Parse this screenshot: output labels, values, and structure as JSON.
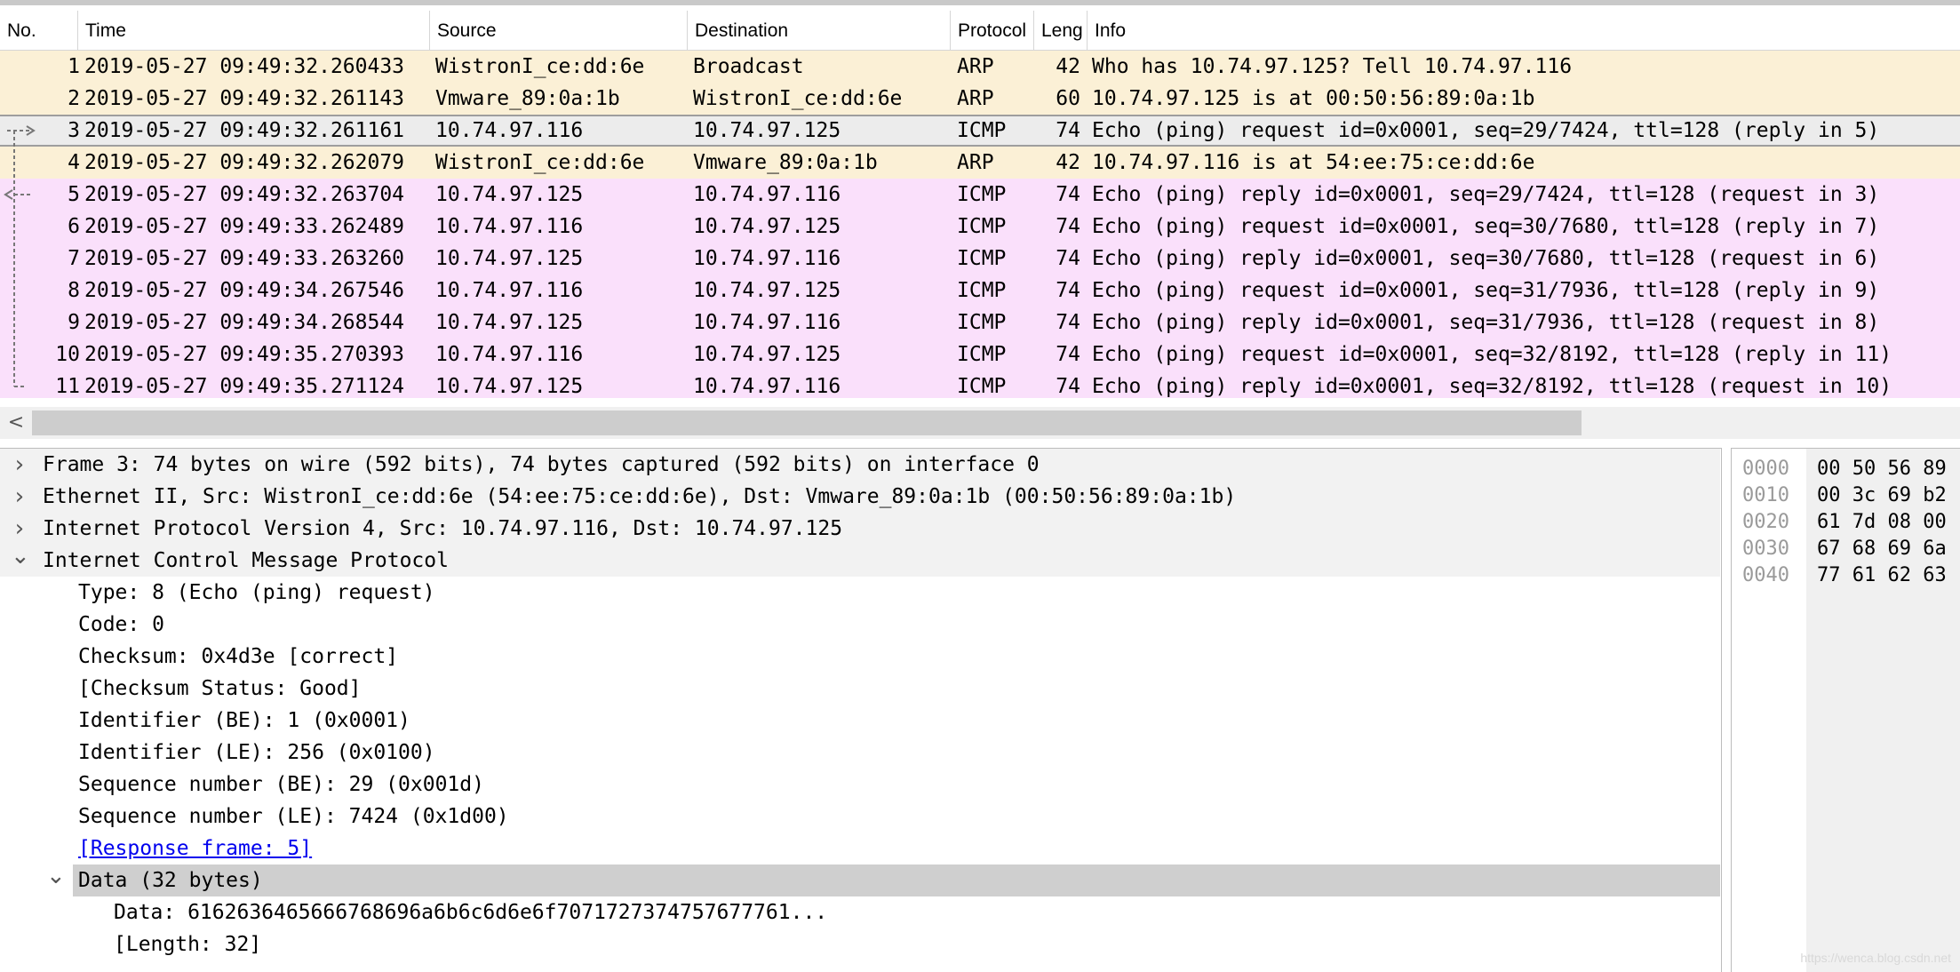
{
  "packet_list": {
    "columns": [
      {
        "key": "no",
        "label": "No."
      },
      {
        "key": "time",
        "label": "Time"
      },
      {
        "key": "source",
        "label": "Source"
      },
      {
        "key": "destination",
        "label": "Destination"
      },
      {
        "key": "protocol",
        "label": "Protocol"
      },
      {
        "key": "length",
        "label": "Leng"
      },
      {
        "key": "info",
        "label": "Info"
      }
    ],
    "rows": [
      {
        "no": "1",
        "time": "2019-05-27 09:49:32.260433",
        "source": "WistronI_ce:dd:6e",
        "destination": "Broadcast",
        "protocol": "ARP",
        "length": "42",
        "info": "Who has 10.74.97.125? Tell 10.74.97.116",
        "kind": "arp"
      },
      {
        "no": "2",
        "time": "2019-05-27 09:49:32.261143",
        "source": "Vmware_89:0a:1b",
        "destination": "WistronI_ce:dd:6e",
        "protocol": "ARP",
        "length": "60",
        "info": "10.74.97.125 is at 00:50:56:89:0a:1b",
        "kind": "arp"
      },
      {
        "no": "3",
        "time": "2019-05-27 09:49:32.261161",
        "source": "10.74.97.116",
        "destination": "10.74.97.125",
        "protocol": "ICMP",
        "length": "74",
        "info": "Echo (ping) request  id=0x0001, seq=29/7424, ttl=128 (reply in 5)",
        "kind": "selected"
      },
      {
        "no": "4",
        "time": "2019-05-27 09:49:32.262079",
        "source": "WistronI_ce:dd:6e",
        "destination": "Vmware_89:0a:1b",
        "protocol": "ARP",
        "length": "42",
        "info": "10.74.97.116 is at 54:ee:75:ce:dd:6e",
        "kind": "arp"
      },
      {
        "no": "5",
        "time": "2019-05-27 09:49:32.263704",
        "source": "10.74.97.125",
        "destination": "10.74.97.116",
        "protocol": "ICMP",
        "length": "74",
        "info": "Echo (ping) reply    id=0x0001, seq=29/7424, ttl=128 (request in 3)",
        "kind": "icmp"
      },
      {
        "no": "6",
        "time": "2019-05-27 09:49:33.262489",
        "source": "10.74.97.116",
        "destination": "10.74.97.125",
        "protocol": "ICMP",
        "length": "74",
        "info": "Echo (ping) request  id=0x0001, seq=30/7680, ttl=128 (reply in 7)",
        "kind": "icmp"
      },
      {
        "no": "7",
        "time": "2019-05-27 09:49:33.263260",
        "source": "10.74.97.125",
        "destination": "10.74.97.116",
        "protocol": "ICMP",
        "length": "74",
        "info": "Echo (ping) reply    id=0x0001, seq=30/7680, ttl=128 (request in 6)",
        "kind": "icmp"
      },
      {
        "no": "8",
        "time": "2019-05-27 09:49:34.267546",
        "source": "10.74.97.116",
        "destination": "10.74.97.125",
        "protocol": "ICMP",
        "length": "74",
        "info": "Echo (ping) request  id=0x0001, seq=31/7936, ttl=128 (reply in 9)",
        "kind": "icmp"
      },
      {
        "no": "9",
        "time": "2019-05-27 09:49:34.268544",
        "source": "10.74.97.125",
        "destination": "10.74.97.116",
        "protocol": "ICMP",
        "length": "74",
        "info": "Echo (ping) reply    id=0x0001, seq=31/7936, ttl=128 (request in 8)",
        "kind": "icmp"
      },
      {
        "no": "10",
        "time": "2019-05-27 09:49:35.270393",
        "source": "10.74.97.116",
        "destination": "10.74.97.125",
        "protocol": "ICMP",
        "length": "74",
        "info": "Echo (ping) request  id=0x0001, seq=32/8192, ttl=128 (reply in 11)",
        "kind": "icmp"
      },
      {
        "no": "11",
        "time": "2019-05-27 09:49:35.271124",
        "source": "10.74.97.125",
        "destination": "10.74.97.116",
        "protocol": "ICMP",
        "length": "74",
        "info": "Echo (ping) reply    id=0x0001, seq=32/8192, ttl=128 (request in 10)",
        "kind": "icmp"
      }
    ]
  },
  "scrollbar": {
    "left_arrow": "<"
  },
  "details": [
    {
      "text": "Frame 3: 74 bytes on wire (592 bits), 74 bytes captured (592 bits) on interface 0",
      "level": 0,
      "expander": "collapsed"
    },
    {
      "text": "Ethernet II, Src: WistronI_ce:dd:6e (54:ee:75:ce:dd:6e), Dst: Vmware_89:0a:1b (00:50:56:89:0a:1b)",
      "level": 0,
      "expander": "collapsed"
    },
    {
      "text": "Internet Protocol Version 4, Src: 10.74.97.116, Dst: 10.74.97.125",
      "level": 0,
      "expander": "collapsed"
    },
    {
      "text": "Internet Control Message Protocol",
      "level": 0,
      "expander": "expanded"
    },
    {
      "text": "Type: 8 (Echo (ping) request)",
      "level": 1,
      "expander": "none"
    },
    {
      "text": "Code: 0",
      "level": 1,
      "expander": "none"
    },
    {
      "text": "Checksum: 0x4d3e [correct]",
      "level": 1,
      "expander": "none"
    },
    {
      "text": "[Checksum Status: Good]",
      "level": 1,
      "expander": "none"
    },
    {
      "text": "Identifier (BE): 1 (0x0001)",
      "level": 1,
      "expander": "none"
    },
    {
      "text": "Identifier (LE): 256 (0x0100)",
      "level": 1,
      "expander": "none"
    },
    {
      "text": "Sequence number (BE): 29 (0x001d)",
      "level": 1,
      "expander": "none"
    },
    {
      "text": "Sequence number (LE): 7424 (0x1d00)",
      "level": 1,
      "expander": "none"
    },
    {
      "text": "[Response frame: 5]",
      "level": 1,
      "expander": "none",
      "link": true
    },
    {
      "text": "Data (32 bytes)",
      "level": 1,
      "expander": "expanded",
      "selected": true
    },
    {
      "text": "Data: 6162636465666768696a6b6c6d6e6f7071727374757677761...",
      "level": 2,
      "expander": "none"
    },
    {
      "text": "[Length: 32]",
      "level": 2,
      "expander": "none"
    }
  ],
  "hex": [
    {
      "offset": "0000",
      "bytes": "00 50 56 89"
    },
    {
      "offset": "0010",
      "bytes": "00 3c 69 b2"
    },
    {
      "offset": "0020",
      "bytes": "61 7d 08 00"
    },
    {
      "offset": "0030",
      "bytes": "67 68 69 6a"
    },
    {
      "offset": "0040",
      "bytes": "77 61 62 63"
    }
  ],
  "watermark": "https://wenca.blog.csdn.net",
  "colors": {
    "arp_row": "#fbf0d6",
    "icmp_row": "#fae0fb",
    "selected_row": "#ececec",
    "link": "#0000ee"
  }
}
